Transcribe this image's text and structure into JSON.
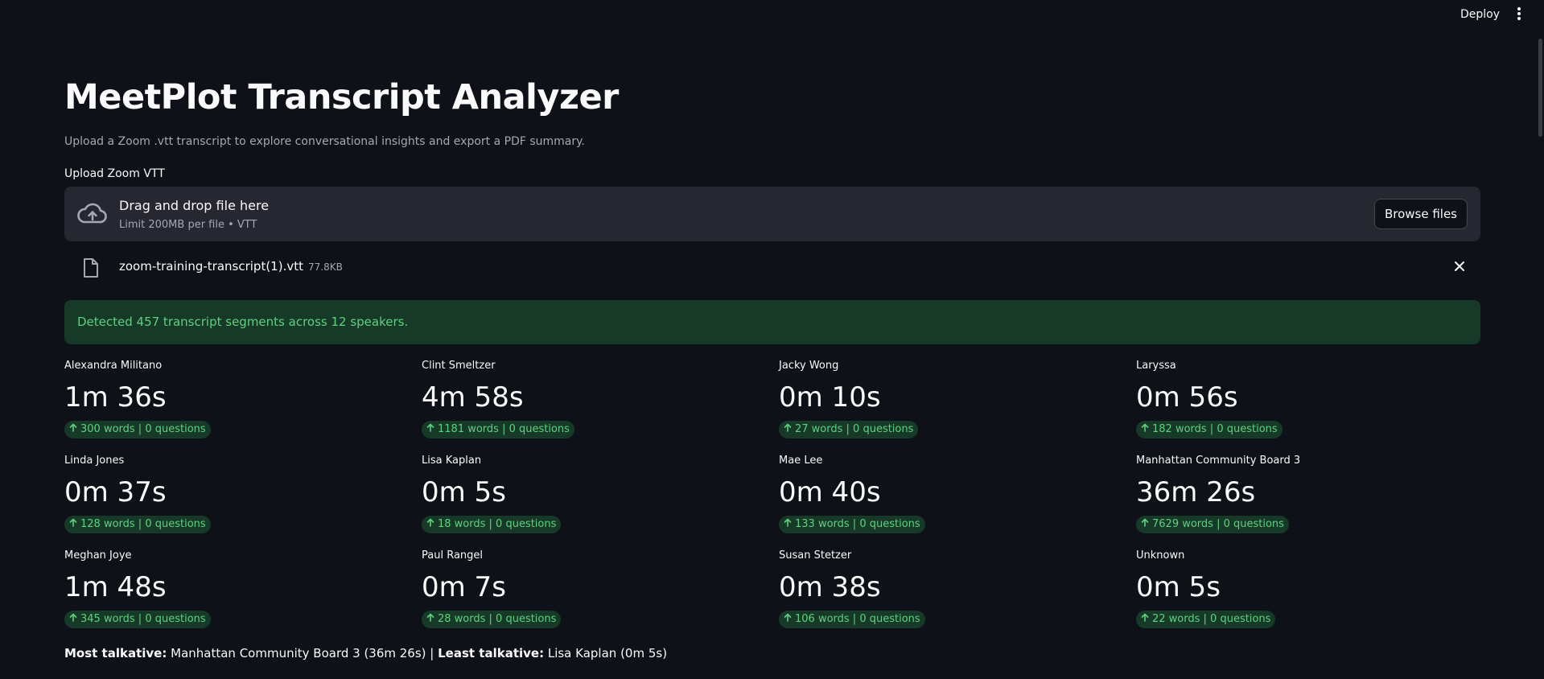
{
  "header": {
    "deploy_label": "Deploy"
  },
  "page": {
    "title": "MeetPlot Transcript Analyzer",
    "subtitle": "Upload a Zoom .vtt transcript to explore conversational insights and export a PDF summary."
  },
  "uploader": {
    "label": "Upload Zoom VTT",
    "drop_text": "Drag and drop file here",
    "limit_text": "Limit 200MB per file • VTT",
    "browse_label": "Browse files",
    "file": {
      "name": "zoom-training-transcript(1).vtt",
      "size": "77.8KB"
    }
  },
  "alert": {
    "text": "Detected 457 transcript segments across 12 speakers."
  },
  "speakers": [
    {
      "name": "Alexandra Militano",
      "time": "1m 36s",
      "delta": "300 words | 0 questions"
    },
    {
      "name": "Clint Smeltzer",
      "time": "4m 58s",
      "delta": "1181 words | 0 questions"
    },
    {
      "name": "Jacky Wong",
      "time": "0m 10s",
      "delta": "27 words | 0 questions"
    },
    {
      "name": "Laryssa",
      "time": "0m 56s",
      "delta": "182 words | 0 questions"
    },
    {
      "name": "Linda Jones",
      "time": "0m 37s",
      "delta": "128 words | 0 questions"
    },
    {
      "name": "Lisa Kaplan",
      "time": "0m 5s",
      "delta": "18 words | 0 questions"
    },
    {
      "name": "Mae Lee",
      "time": "0m 40s",
      "delta": "133 words | 0 questions"
    },
    {
      "name": "Manhattan Community Board 3",
      "time": "36m 26s",
      "delta": "7629 words | 0 questions"
    },
    {
      "name": "Meghan Joye",
      "time": "1m 48s",
      "delta": "345 words | 0 questions"
    },
    {
      "name": "Paul Rangel",
      "time": "0m 7s",
      "delta": "28 words | 0 questions"
    },
    {
      "name": "Susan Stetzer",
      "time": "0m 38s",
      "delta": "106 words | 0 questions"
    },
    {
      "name": "Unknown",
      "time": "0m 5s",
      "delta": "22 words | 0 questions"
    }
  ],
  "summary": {
    "most_label": "Most talkative:",
    "most_value": " Manhattan Community Board 3 (36m 26s) | ",
    "least_label": "Least talkative:",
    "least_value": " Lisa Kaplan (0m 5s)"
  },
  "colors": {
    "background": "#0e1117",
    "success": "#5ed17f",
    "success_bg": "#173928"
  }
}
